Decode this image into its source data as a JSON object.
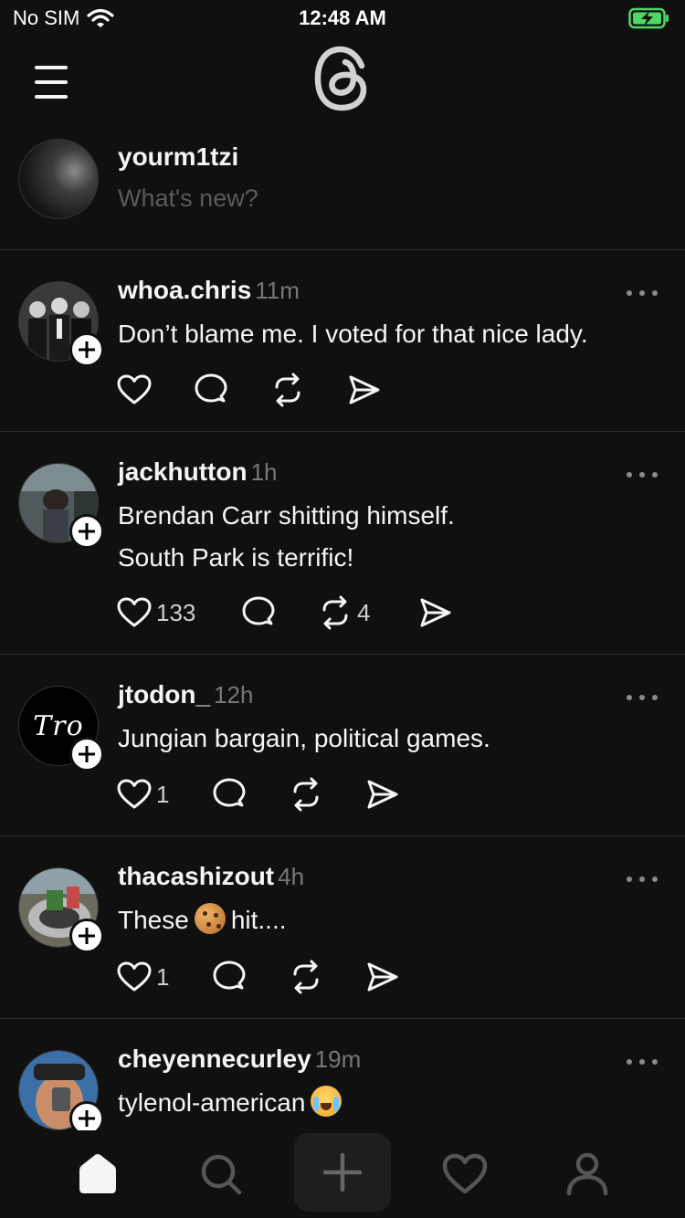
{
  "status": {
    "carrier": "No SIM",
    "time": "12:48 AM"
  },
  "compose": {
    "username": "yourm1tzi",
    "placeholder": "What's new?"
  },
  "posts": [
    {
      "username": "whoa.chris",
      "time": "11m",
      "lines": [
        "Don’t blame me. I voted for that nice lady."
      ],
      "likes": "",
      "reposts": ""
    },
    {
      "username": "jackhutton",
      "time": "1h",
      "lines": [
        "Brendan Carr shitting himself.",
        "South Park is terrific!"
      ],
      "likes": "133",
      "reposts": "4"
    },
    {
      "username": "jtodon_",
      "time": "12h",
      "lines": [
        "Jungian bargain, political games."
      ],
      "likes": "1",
      "reposts": "",
      "avatar_text": "Tro"
    },
    {
      "username": "thacashizout",
      "time": "4h",
      "text_before": "These",
      "text_after": "hit....",
      "likes": "1",
      "reposts": ""
    },
    {
      "username": "cheyennecurley",
      "time": "19m",
      "text_before": "tylenol-american"
    }
  ],
  "icons": {
    "menu": "hamburger-icon",
    "logo": "threads-logo-icon",
    "more": "more-horizontal-icon",
    "like": "heart-icon",
    "reply": "comment-icon",
    "repost": "repost-icon",
    "share": "send-icon",
    "home": "home-icon",
    "search": "search-icon",
    "create": "plus-icon",
    "activity": "heart-icon",
    "profile": "user-icon",
    "emoji_cookie": "cookie-emoji",
    "emoji_crying": "loudly-crying-face-emoji"
  },
  "colors": {
    "background": "#101010",
    "text": "#f3f5f7",
    "muted": "#777777",
    "divider": "#2e2e2e",
    "placeholder": "#5a5a5a"
  }
}
